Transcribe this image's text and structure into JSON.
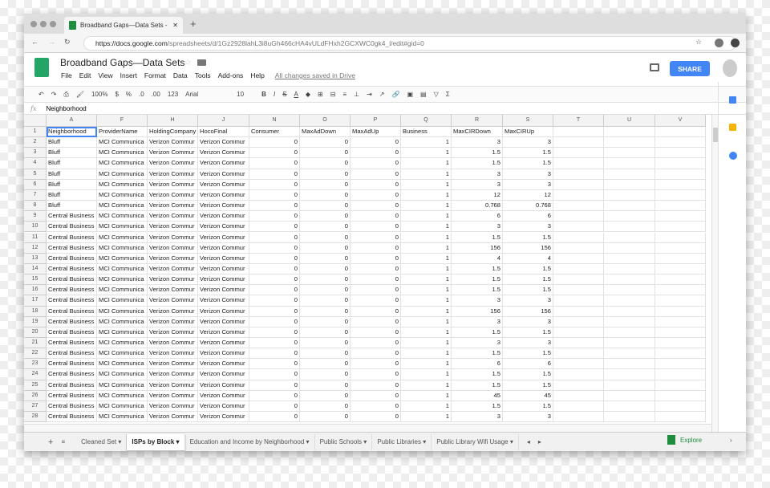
{
  "browser": {
    "tab_title": "Broadband Gaps—Data Sets -",
    "url_host": "https://docs.google.com",
    "url_path": "/spreadsheets/d/1Gz2928lahL3i8uGh466cHA4vULdFHxh2GCXWC0gk4_l/edit#gid=0"
  },
  "doc": {
    "title": "Broadband Gaps—Data Sets",
    "menu": [
      "File",
      "Edit",
      "View",
      "Insert",
      "Format",
      "Data",
      "Tools",
      "Add-ons",
      "Help"
    ],
    "saved": "All changes saved in Drive",
    "share": "SHARE"
  },
  "toolbar": {
    "zoom": "100%",
    "currency": "$",
    "percent": "%",
    "dec_less": ".0",
    "dec_more": ".00",
    "format": "123",
    "font": "Arial",
    "size": "10",
    "bold": "B",
    "italic": "I",
    "strike": "S",
    "text_color": "A",
    "sum": "Σ"
  },
  "formula": {
    "fx": "fx",
    "value": "Neighborhood"
  },
  "columns": [
    "A",
    "F",
    "H",
    "J",
    "N",
    "O",
    "P",
    "Q",
    "R",
    "S",
    "T",
    "U",
    "V"
  ],
  "headers": [
    "Neighborhood",
    "ProviderName",
    "HoldingCompany",
    "HocoFinal",
    "Consumer",
    "MaxAdDown",
    "MaxAdUp",
    "Business",
    "MaxCIRDown",
    "MaxCIRUp"
  ],
  "rows": [
    [
      "Bluff",
      "MCI Communica",
      "Verizon Commur",
      "Verizon Commur",
      "0",
      "0",
      "0",
      "1",
      "3",
      "3"
    ],
    [
      "Bluff",
      "MCI Communica",
      "Verizon Commur",
      "Verizon Commur",
      "0",
      "0",
      "0",
      "1",
      "1.5",
      "1.5"
    ],
    [
      "Bluff",
      "MCI Communica",
      "Verizon Commur",
      "Verizon Commur",
      "0",
      "0",
      "0",
      "1",
      "1.5",
      "1.5"
    ],
    [
      "Bluff",
      "MCI Communica",
      "Verizon Commur",
      "Verizon Commur",
      "0",
      "0",
      "0",
      "1",
      "3",
      "3"
    ],
    [
      "Bluff",
      "MCI Communica",
      "Verizon Commur",
      "Verizon Commur",
      "0",
      "0",
      "0",
      "1",
      "3",
      "3"
    ],
    [
      "Bluff",
      "MCI Communica",
      "Verizon Commur",
      "Verizon Commur",
      "0",
      "0",
      "0",
      "1",
      "12",
      "12"
    ],
    [
      "Bluff",
      "MCI Communica",
      "Verizon Commur",
      "Verizon Commur",
      "0",
      "0",
      "0",
      "1",
      "0.768",
      "0.768"
    ],
    [
      "Central Business",
      "MCI Communica",
      "Verizon Commur",
      "Verizon Commur",
      "0",
      "0",
      "0",
      "1",
      "6",
      "6"
    ],
    [
      "Central Business",
      "MCI Communica",
      "Verizon Commur",
      "Verizon Commur",
      "0",
      "0",
      "0",
      "1",
      "3",
      "3"
    ],
    [
      "Central Business",
      "MCI Communica",
      "Verizon Commur",
      "Verizon Commur",
      "0",
      "0",
      "0",
      "1",
      "1.5",
      "1.5"
    ],
    [
      "Central Business",
      "MCI Communica",
      "Verizon Commur",
      "Verizon Commur",
      "0",
      "0",
      "0",
      "1",
      "156",
      "156"
    ],
    [
      "Central Business",
      "MCI Communica",
      "Verizon Commur",
      "Verizon Commur",
      "0",
      "0",
      "0",
      "1",
      "4",
      "4"
    ],
    [
      "Central Business",
      "MCI Communica",
      "Verizon Commur",
      "Verizon Commur",
      "0",
      "0",
      "0",
      "1",
      "1.5",
      "1.5"
    ],
    [
      "Central Business",
      "MCI Communica",
      "Verizon Commur",
      "Verizon Commur",
      "0",
      "0",
      "0",
      "1",
      "1.5",
      "1.5"
    ],
    [
      "Central Business",
      "MCI Communica",
      "Verizon Commur",
      "Verizon Commur",
      "0",
      "0",
      "0",
      "1",
      "1.5",
      "1.5"
    ],
    [
      "Central Business",
      "MCI Communica",
      "Verizon Commur",
      "Verizon Commur",
      "0",
      "0",
      "0",
      "1",
      "3",
      "3"
    ],
    [
      "Central Business",
      "MCI Communica",
      "Verizon Commur",
      "Verizon Commur",
      "0",
      "0",
      "0",
      "1",
      "156",
      "156"
    ],
    [
      "Central Business",
      "MCI Communica",
      "Verizon Commur",
      "Verizon Commur",
      "0",
      "0",
      "0",
      "1",
      "3",
      "3"
    ],
    [
      "Central Business",
      "MCI Communica",
      "Verizon Commur",
      "Verizon Commur",
      "0",
      "0",
      "0",
      "1",
      "1.5",
      "1.5"
    ],
    [
      "Central Business",
      "MCI Communica",
      "Verizon Commur",
      "Verizon Commur",
      "0",
      "0",
      "0",
      "1",
      "3",
      "3"
    ],
    [
      "Central Business",
      "MCI Communica",
      "Verizon Commur",
      "Verizon Commur",
      "0",
      "0",
      "0",
      "1",
      "1.5",
      "1.5"
    ],
    [
      "Central Business",
      "MCI Communica",
      "Verizon Commur",
      "Verizon Commur",
      "0",
      "0",
      "0",
      "1",
      "6",
      "6"
    ],
    [
      "Central Business",
      "MCI Communica",
      "Verizon Commur",
      "Verizon Commur",
      "0",
      "0",
      "0",
      "1",
      "1.5",
      "1.5"
    ],
    [
      "Central Business",
      "MCI Communica",
      "Verizon Commur",
      "Verizon Commur",
      "0",
      "0",
      "0",
      "1",
      "1.5",
      "1.5"
    ],
    [
      "Central Business",
      "MCI Communica",
      "Verizon Commur",
      "Verizon Commur",
      "0",
      "0",
      "0",
      "1",
      "45",
      "45"
    ],
    [
      "Central Business",
      "MCI Communica",
      "Verizon Commur",
      "Verizon Commur",
      "0",
      "0",
      "0",
      "1",
      "1.5",
      "1.5"
    ],
    [
      "Central Business",
      "MCI Communica",
      "Verizon Commur",
      "Verizon Commur",
      "0",
      "0",
      "0",
      "1",
      "3",
      "3"
    ]
  ],
  "sheets": [
    "Cleaned Set",
    "ISPs by Block",
    "Education and Income by Neighborhood",
    "Public Schools",
    "Public Libraries",
    "Public Library Wifi Usage"
  ],
  "active_sheet": "ISPs by Block",
  "explore": "Explore",
  "colors": {
    "accent": "#4285f4",
    "sheets_green": "#1e8e3e",
    "selection": "#4285f4"
  }
}
